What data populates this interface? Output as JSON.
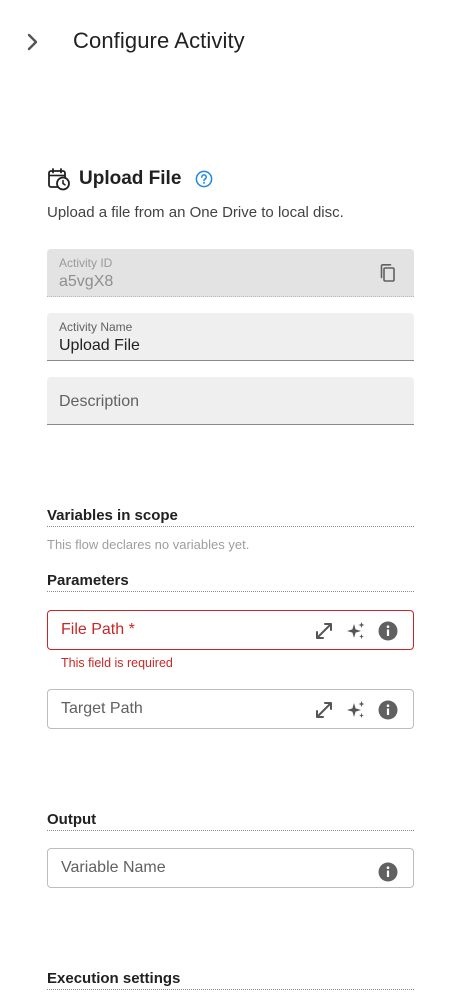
{
  "header": {
    "title": "Configure Activity",
    "collapse_icon": "chevron-right-icon"
  },
  "activity": {
    "icon": "calendar-clock-icon",
    "name": "Upload File",
    "help_icon": "help-circle-icon",
    "description": "Upload a file from an One Drive to local disc."
  },
  "fields": {
    "activity_id": {
      "label": "Activity ID",
      "value": "a5vgX8",
      "copy_icon": "copy-icon"
    },
    "activity_name": {
      "label": "Activity Name",
      "value": "Upload File"
    },
    "description": {
      "placeholder": "Description"
    }
  },
  "variables": {
    "title": "Variables in scope",
    "empty_note": "This flow declares no variables yet."
  },
  "parameters": {
    "title": "Parameters",
    "file_path": {
      "placeholder": "File Path *",
      "error": "This field is required"
    },
    "target_path": {
      "placeholder": "Target Path"
    },
    "icons": [
      "expand-icon",
      "sparkle-icon",
      "info-icon"
    ]
  },
  "output": {
    "title": "Output",
    "variable_name": {
      "placeholder": "Variable Name"
    }
  },
  "execution": {
    "title": "Execution settings"
  },
  "colors": {
    "error": "#c62828",
    "accent": "#1e88e5",
    "field_bg": "#efefef"
  }
}
